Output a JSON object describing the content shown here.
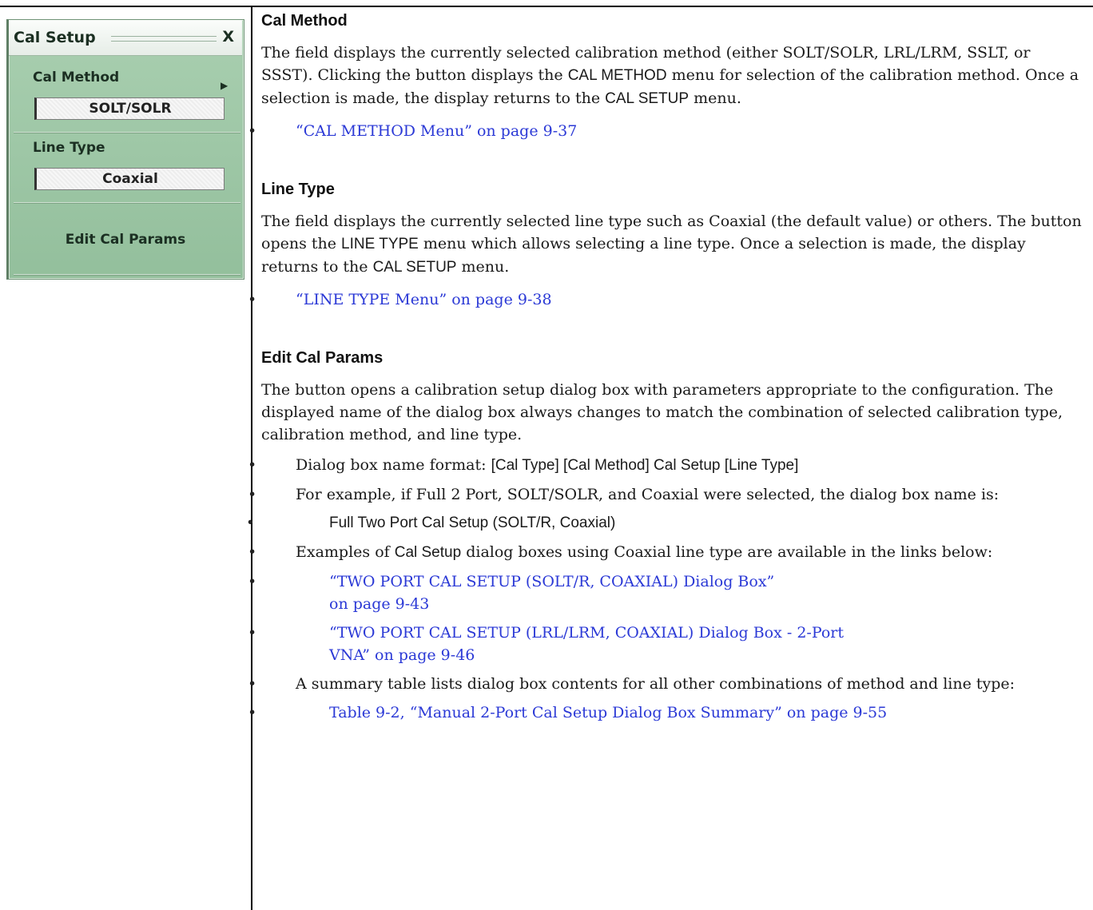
{
  "menu": {
    "title": "Cal Setup",
    "close": "X",
    "cal_method_label": "Cal Method",
    "cal_method_value": "SOLT/SOLR",
    "line_type_label": "Line Type",
    "line_type_value": "Coaxial",
    "edit_button": "Edit Cal Params"
  },
  "sections": {
    "cal_method": {
      "heading": "Cal Method",
      "p_a": "The field displays the currently selected calibration method (either SOLT/SOLR, LRL/LRM, SSLT, or SSST). Clicking the button displays the ",
      "p_b": "CAL METHOD",
      "p_c": " menu for selection of the calibration method. Once a selection is made, the display returns to the ",
      "p_d": "CAL SETUP",
      "p_e": " menu.",
      "link": "“CAL METHOD Menu” on page 9-37"
    },
    "line_type": {
      "heading": "Line Type",
      "p_a": "The field displays the currently selected line type such as Coaxial (the default value) or others. The button opens the ",
      "p_b": "LINE TYPE",
      "p_c": " menu which allows selecting a line type. Once a selection is made, the display returns to the ",
      "p_d": "CAL SETUP",
      "p_e": " menu.",
      "link": "“LINE TYPE Menu” on page 9-38"
    },
    "edit": {
      "heading": "Edit Cal Params",
      "p": "The button opens a calibration setup dialog box with parameters appropriate to the configuration. The displayed name of the dialog box always changes to match the combination of selected calibration type, calibration method, and line type.",
      "b1_a": "Dialog box name format: ",
      "b1_b": "[Cal Type] [Cal Method] Cal Setup [Line Type]",
      "b2": "For example, if Full 2 Port, SOLT/SOLR, and Coaxial were selected, the dialog box name is:",
      "b2_sub": "Full Two Port Cal Setup (SOLT/R, Coaxial)",
      "b3_a": "Examples of ",
      "b3_b": "Cal Setup",
      "b3_c": " dialog boxes using Coaxial line type are available in the links below:",
      "link1_l1": "“TWO PORT CAL SETUP (SOLT/R, COAXIAL) Dialog Box”",
      "link1_l2": "on page 9-43",
      "link2_l1": "“TWO PORT CAL SETUP (LRL/LRM, COAXIAL) Dialog Box - 2-Port",
      "link2_l2": "VNA” on page 9-46",
      "b4": "A summary table lists dialog box contents for all other combinations of method and line type:",
      "link3": "Table 9-2, “Manual 2-Port Cal Setup Dialog Box Summary” on page 9-55"
    }
  }
}
